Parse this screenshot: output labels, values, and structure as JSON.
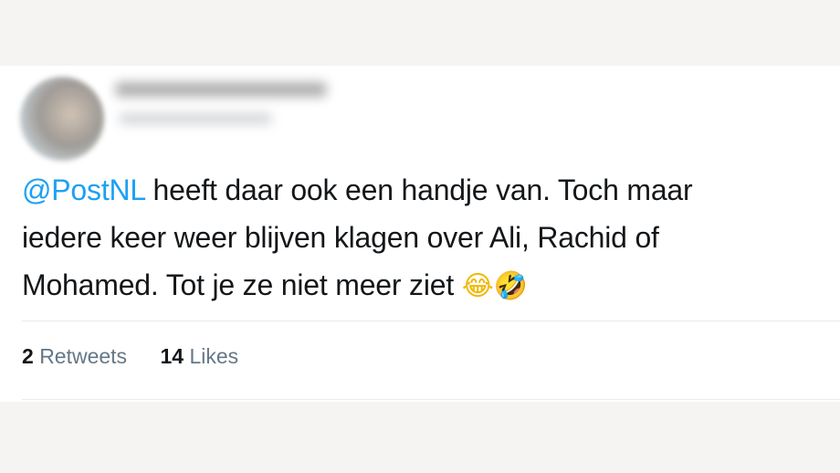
{
  "tweet": {
    "mention": "@PostNL",
    "text_line1": " heeft daar ook een handje van. Toch maar",
    "text_line2": "iedere keer weer blijven klagen over Ali, Rachid of",
    "text_line3": "Mohamed. Tot je ze niet meer ziet ",
    "emoji_1": "😂",
    "emoji_2": "🤣"
  },
  "stats": {
    "retweets_count": "2",
    "retweets_label": "Retweets",
    "likes_count": "14",
    "likes_label": "Likes"
  },
  "colors": {
    "mention": "#1da1f2",
    "text": "#14171a",
    "secondary": "#657786",
    "divider": "#e6ecf0"
  }
}
